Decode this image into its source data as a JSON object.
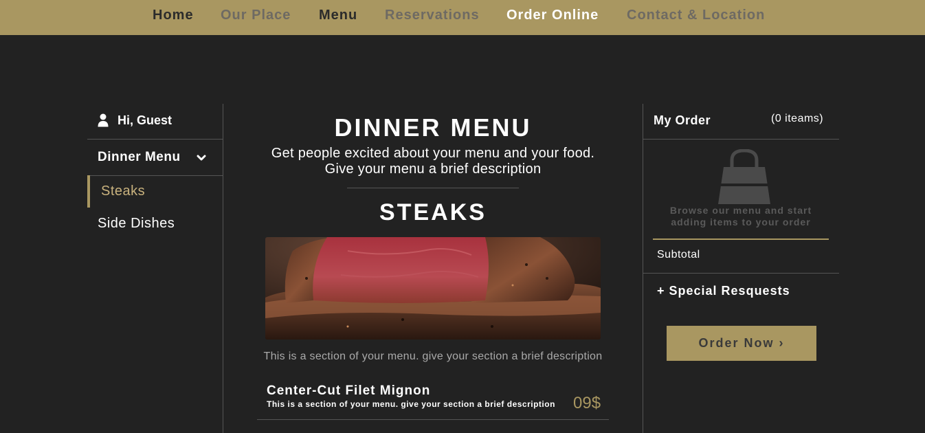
{
  "nav": {
    "items": [
      {
        "label": "Home",
        "color": "#2b2b2b"
      },
      {
        "label": "Our Place",
        "color": "#6e6a63"
      },
      {
        "label": "Menu",
        "color": "#2b2b2b"
      },
      {
        "label": "Reservations",
        "color": "#6e6a63"
      },
      {
        "label": "Order Online",
        "color": "#ffffff"
      },
      {
        "label": "Contact & Location",
        "color": "#6e6a63"
      }
    ]
  },
  "sidebar": {
    "greeting": "Hi, Guest",
    "menu_selector": "Dinner Menu",
    "sections": [
      {
        "label": "Steaks",
        "active": true
      },
      {
        "label": "Side Dishes",
        "active": false
      }
    ]
  },
  "main": {
    "menu_title": "DINNER MENU",
    "menu_description_line1": "Get people excited about your menu and your food.",
    "menu_description_line2": "Give your menu a brief description",
    "section_title": "STEAKS",
    "section_description": "This is a section of your menu. give your section a brief description",
    "items": [
      {
        "name": "Center-Cut Filet Mignon",
        "description": "This is a section of your menu. give your section a brief description",
        "price": "09$"
      }
    ]
  },
  "order": {
    "title": "My Order",
    "count": "(0 iteams)",
    "empty_line1": "Browse our menu and start",
    "empty_line2": "adding items to your order",
    "subtotal_label": "Subtotal",
    "special_requests": "+ Special Resquests",
    "order_button": "Order Now",
    "order_button_icon": "chevron-right-icon"
  },
  "colors": {
    "background": "#222222",
    "accent": "#a99761",
    "accent_light": "#c9b27e",
    "divider": "#555555"
  }
}
